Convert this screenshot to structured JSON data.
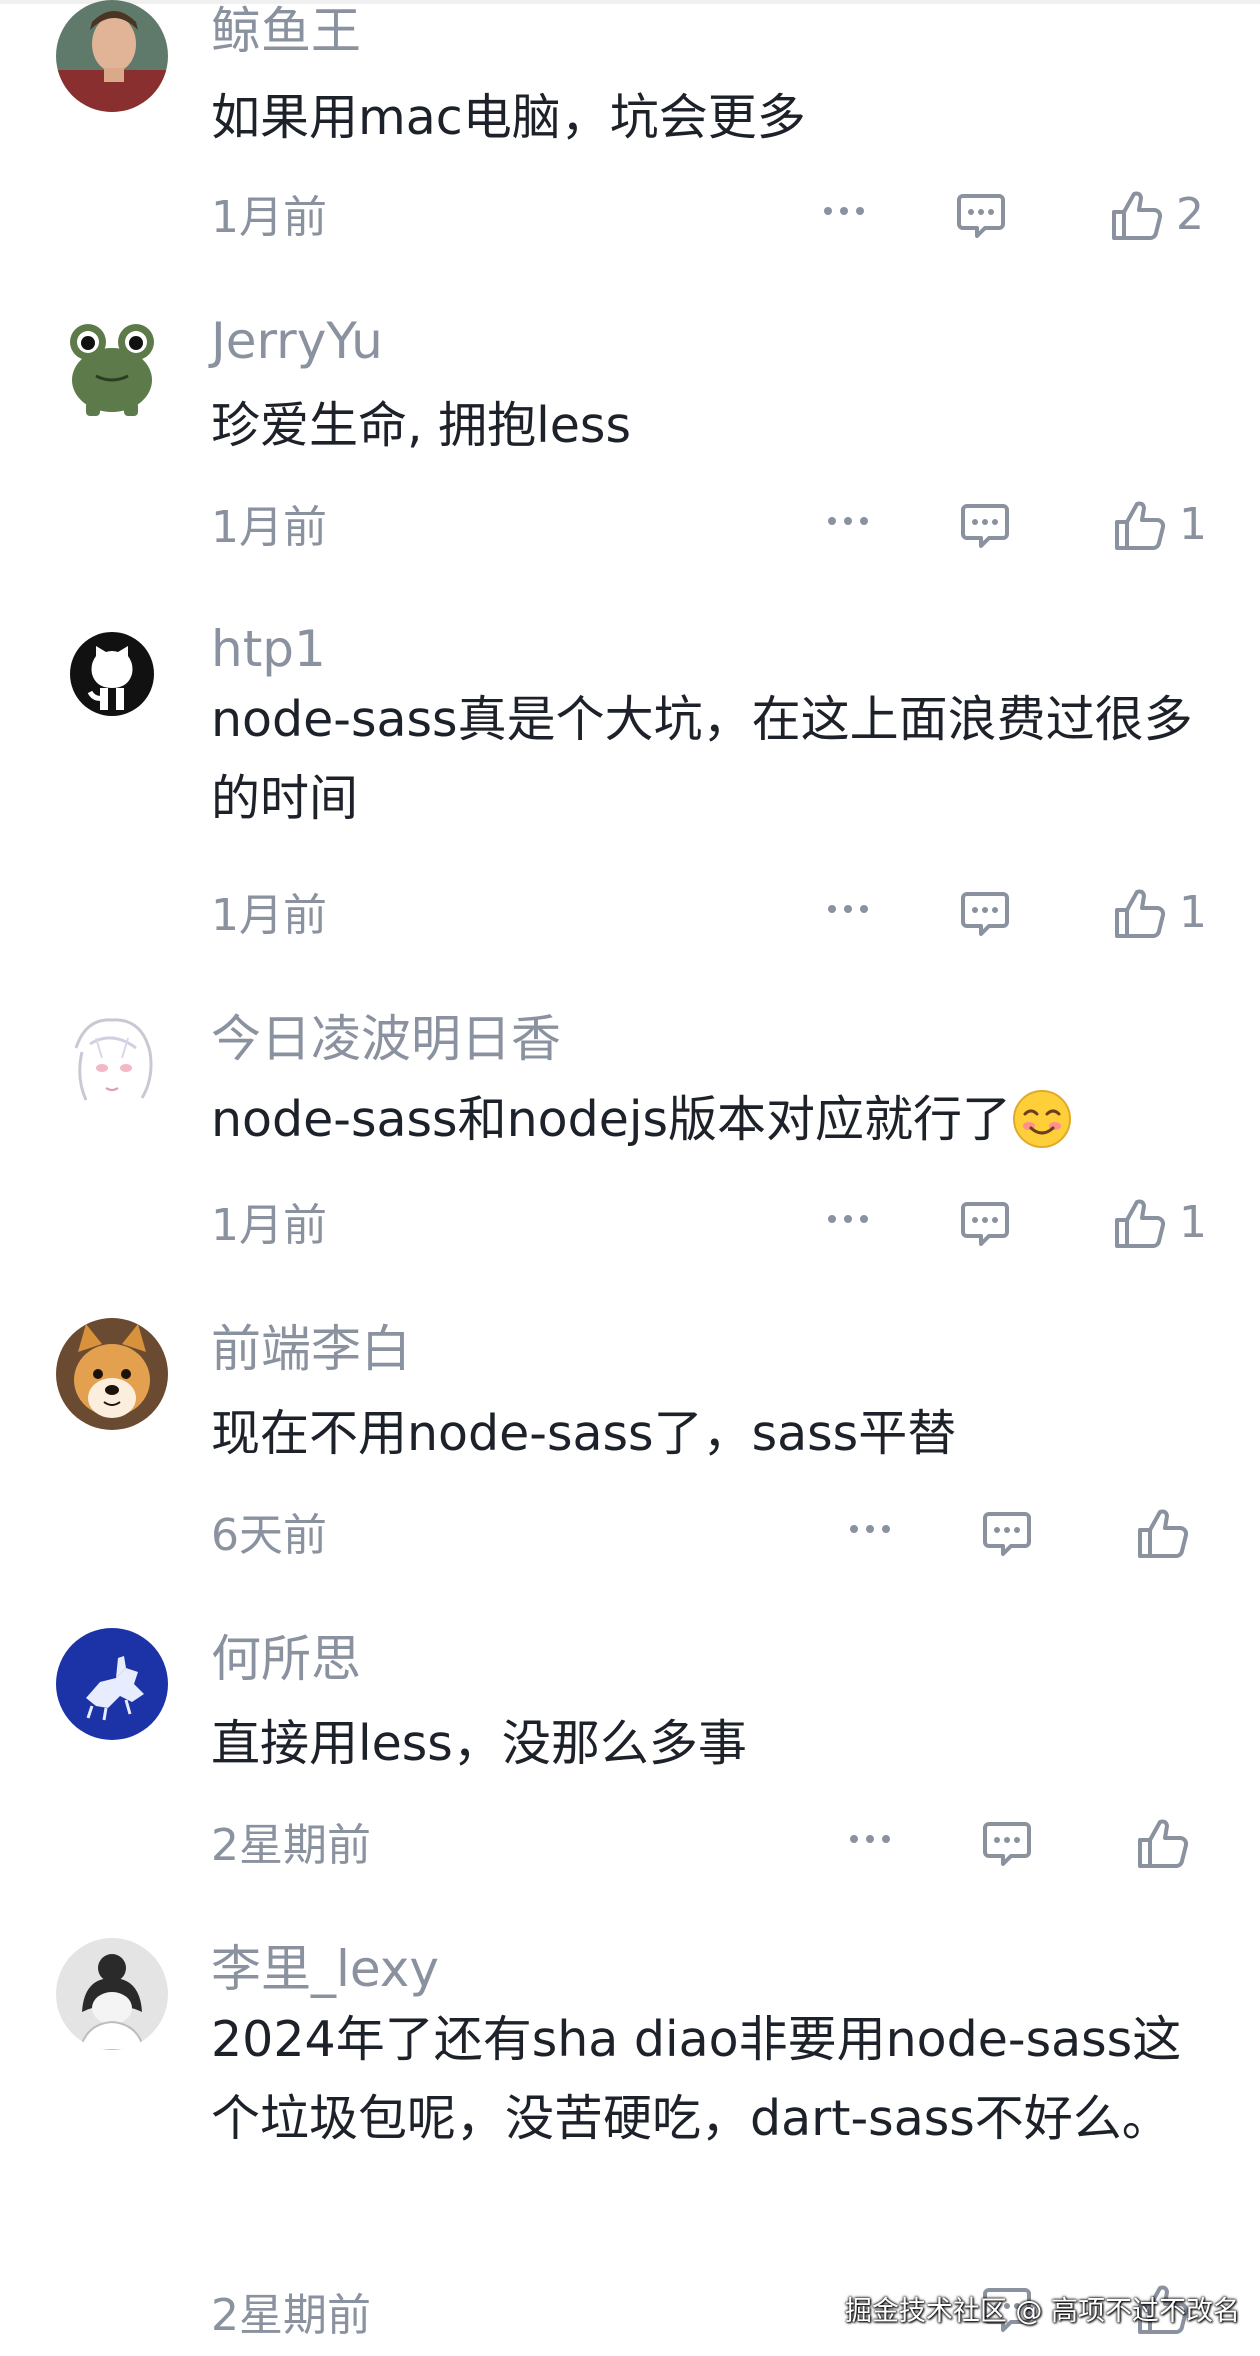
{
  "comments": [
    {
      "username": "鲸鱼王",
      "text": "如果用mac电脑，坑会更多",
      "time": "1月前",
      "likes": "2",
      "avatar": "man-portrait"
    },
    {
      "username": "JerryYu",
      "text": "珍爱生命, 拥抱less",
      "time": "1月前",
      "likes": "1",
      "avatar": "frog"
    },
    {
      "username": "htp1",
      "text": "node-sass真是个大坑，在这上面浪费过很多的时间",
      "time": "1月前",
      "likes": "1",
      "avatar": "github-octocat"
    },
    {
      "username": "今日凌波明日香",
      "text": "node-sass和nodejs版本对应就行了",
      "time": "1月前",
      "likes": "1",
      "avatar": "anime-girl-sketch",
      "emoji": "blush-smile-emoji"
    },
    {
      "username": "前端李白",
      "text": "现在不用node-sass了，sass平替",
      "time": "6天前",
      "likes": "",
      "avatar": "shiba-dog"
    },
    {
      "username": "何所思",
      "text": "直接用less，没那么多事",
      "time": "2星期前",
      "likes": "",
      "avatar": "knight-emblem-blue"
    },
    {
      "username": "李里_lexy",
      "text": "2024年了还有sha diao非要用node-sass这个垃圾包呢，没苦硬吃，dart-sass不好么。",
      "time": "2星期前",
      "likes": "",
      "avatar": "sketch-girl"
    }
  ],
  "icons": {
    "more": "more-dots-icon",
    "reply": "comment-bubble-icon",
    "like": "thumbs-up-icon"
  },
  "colors": {
    "text": "#1d2129",
    "muted": "#8a919f"
  },
  "watermark": "掘金技术社区 @ 高项不过不改名"
}
